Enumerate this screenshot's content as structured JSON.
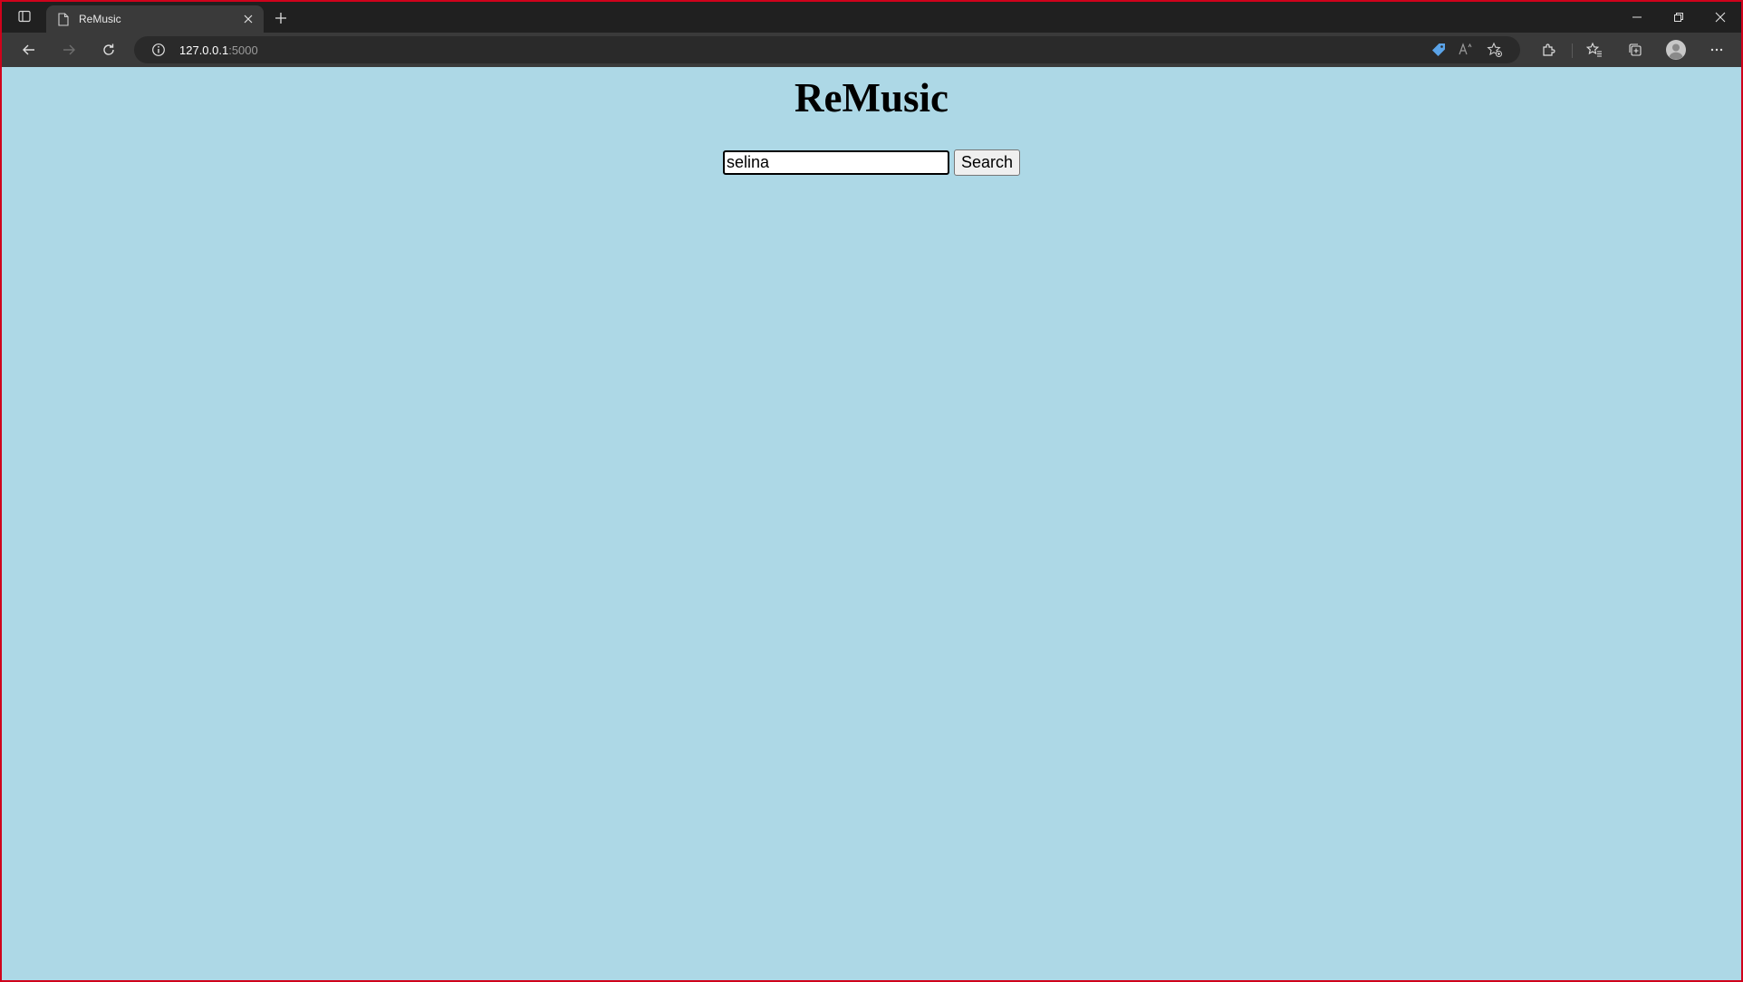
{
  "browser": {
    "tab": {
      "title": "ReMusic"
    },
    "address": {
      "host": "127.0.0.1",
      "port": ":5000"
    }
  },
  "page": {
    "title": "ReMusic",
    "search": {
      "value": "selina",
      "button_label": "Search"
    }
  },
  "colors": {
    "page_background": "#add8e6",
    "window_border": "#d0021b"
  },
  "icons": [
    "tab-actions-icon",
    "page-icon",
    "close-icon",
    "plus-icon",
    "minimize-icon",
    "restore-icon",
    "close-window-icon",
    "back-icon",
    "forward-icon",
    "refresh-icon",
    "info-icon",
    "coupon-tag-icon",
    "read-aloud-icon",
    "add-favorite-icon",
    "extensions-icon",
    "favorites-icon",
    "collections-icon",
    "profile-icon",
    "more-icon"
  ]
}
